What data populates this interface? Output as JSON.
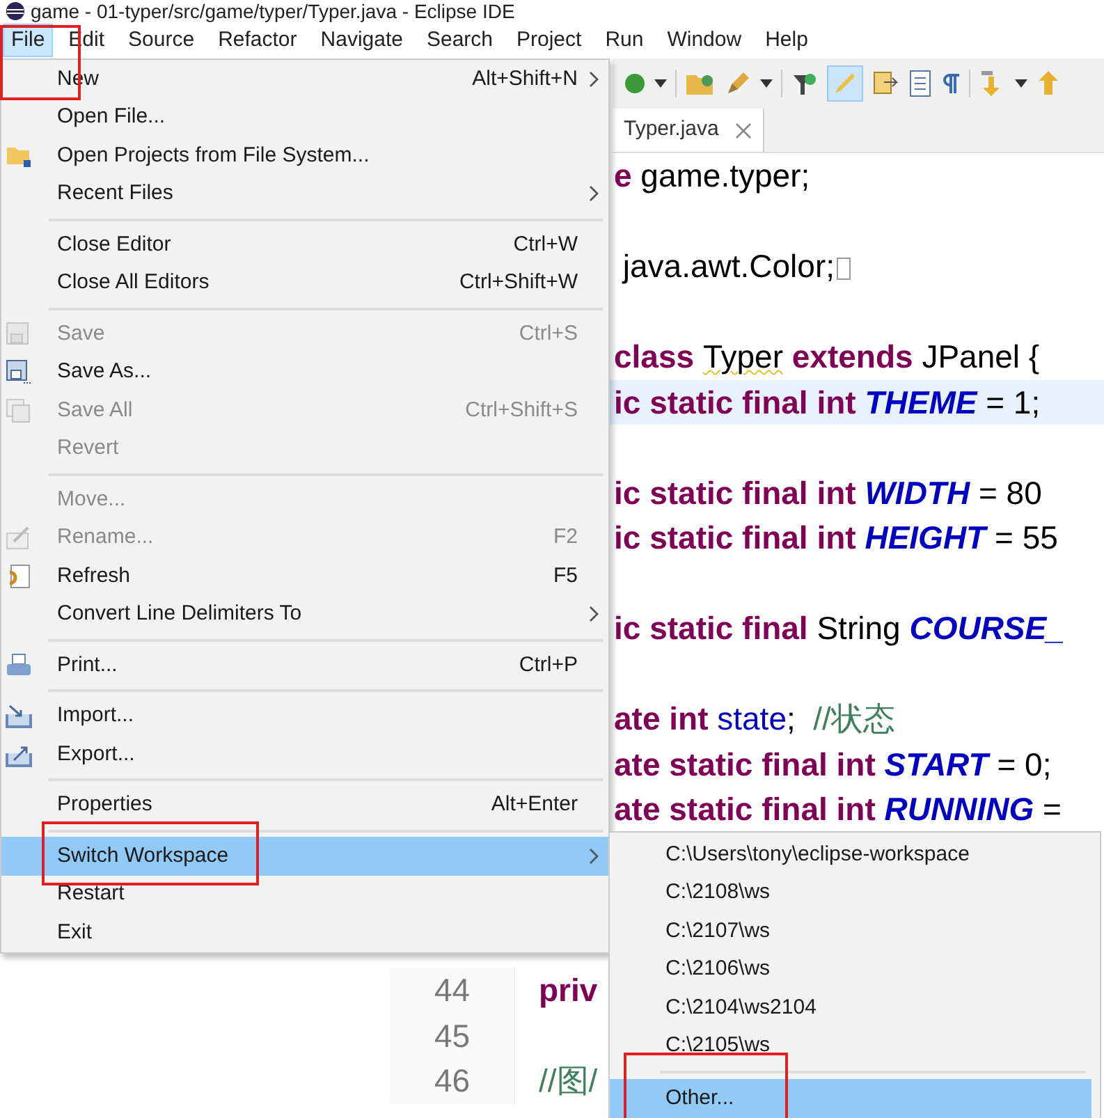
{
  "window": {
    "title": "game - 01-typer/src/game/typer/Typer.java - Eclipse IDE"
  },
  "menu_bar": [
    {
      "label": "File",
      "selected": true
    },
    {
      "label": "Edit",
      "selected": false
    },
    {
      "label": "Source",
      "selected": false
    },
    {
      "label": "Refactor",
      "selected": false
    },
    {
      "label": "Navigate",
      "selected": false
    },
    {
      "label": "Search",
      "selected": false
    },
    {
      "label": "Project",
      "selected": false
    },
    {
      "label": "Run",
      "selected": false
    },
    {
      "label": "Window",
      "selected": false
    },
    {
      "label": "Help",
      "selected": false
    }
  ],
  "editor_tab": {
    "label": "Typer.java"
  },
  "file_menu": [
    [
      {
        "label": "New",
        "shortcut": "Alt+Shift+N",
        "submenu": true,
        "disabled": false,
        "selected": false
      },
      {
        "label": "Open File...",
        "submenu": false,
        "disabled": false,
        "selected": false
      },
      {
        "label": "Open Projects from File System...",
        "submenu": false,
        "disabled": false,
        "selected": false
      },
      {
        "label": "Recent Files",
        "submenu": true,
        "disabled": false,
        "selected": false
      }
    ],
    [
      {
        "label": "Close Editor",
        "shortcut": "Ctrl+W",
        "submenu": false,
        "disabled": false,
        "selected": false
      },
      {
        "label": "Close All Editors",
        "shortcut": "Ctrl+Shift+W",
        "submenu": false,
        "disabled": false,
        "selected": false
      }
    ],
    [
      {
        "label": "Save",
        "shortcut": "Ctrl+S",
        "submenu": false,
        "disabled": true,
        "selected": false
      },
      {
        "label": "Save As...",
        "submenu": false,
        "disabled": false,
        "selected": false
      },
      {
        "label": "Save All",
        "shortcut": "Ctrl+Shift+S",
        "submenu": false,
        "disabled": true,
        "selected": false
      },
      {
        "label": "Revert",
        "submenu": false,
        "disabled": true,
        "selected": false
      }
    ],
    [
      {
        "label": "Move...",
        "submenu": false,
        "disabled": true,
        "selected": false
      },
      {
        "label": "Rename...",
        "shortcut": "F2",
        "submenu": false,
        "disabled": true,
        "selected": false
      },
      {
        "label": "Refresh",
        "shortcut": "F5",
        "submenu": false,
        "disabled": false,
        "selected": false
      },
      {
        "label": "Convert Line Delimiters To",
        "submenu": true,
        "disabled": false,
        "selected": false
      }
    ],
    [
      {
        "label": "Print...",
        "shortcut": "Ctrl+P",
        "submenu": false,
        "disabled": false,
        "selected": false
      }
    ],
    [
      {
        "label": "Import...",
        "submenu": false,
        "disabled": false,
        "selected": false
      },
      {
        "label": "Export...",
        "submenu": false,
        "disabled": false,
        "selected": false
      }
    ],
    [
      {
        "label": "Properties",
        "shortcut": "Alt+Enter",
        "submenu": false,
        "disabled": false,
        "selected": false
      }
    ],
    [
      {
        "label": "Switch Workspace",
        "submenu": true,
        "disabled": false,
        "selected": true
      },
      {
        "label": "Restart",
        "submenu": false,
        "disabled": false,
        "selected": false
      },
      {
        "label": "Exit",
        "submenu": false,
        "disabled": false,
        "selected": false
      }
    ]
  ],
  "workspace_submenu": [
    [
      {
        "label": "C:\\Users\\tony\\eclipse-workspace",
        "selected": false
      },
      {
        "label": "C:\\2108\\ws",
        "selected": false
      },
      {
        "label": "C:\\2107\\ws",
        "selected": false
      },
      {
        "label": "C:\\2106\\ws",
        "selected": false
      },
      {
        "label": "C:\\2104\\ws2104",
        "selected": false
      },
      {
        "label": "C:\\2105\\ws",
        "selected": false
      }
    ],
    [
      {
        "label": "Other...",
        "selected": true
      }
    ]
  ],
  "code_lines": [
    {
      "kind": "code",
      "highlighted": false,
      "tokens": [
        {
          "text": "e",
          "kind": "keyword"
        },
        {
          "text": " game.typer;",
          "kind": "plain"
        }
      ]
    },
    {
      "kind": "blank"
    },
    {
      "kind": "code",
      "highlighted": false,
      "folded": true,
      "tokens": [
        {
          "text": " java.awt.Color;",
          "kind": "plain"
        }
      ]
    },
    {
      "kind": "blank"
    },
    {
      "kind": "code",
      "highlighted": false,
      "tokens": [
        {
          "text": "class ",
          "kind": "keyword"
        },
        {
          "text": "Typer",
          "kind": "plain",
          "warning": true
        },
        {
          "text": " extends ",
          "kind": "keyword"
        },
        {
          "text": "JPanel {",
          "kind": "plain"
        }
      ]
    },
    {
      "kind": "code",
      "highlighted": true,
      "tokens": [
        {
          "text": "ic static final int ",
          "kind": "keyword"
        },
        {
          "text": "THEME",
          "kind": "constant"
        },
        {
          "text": " = 1;",
          "kind": "plain"
        }
      ]
    },
    {
      "kind": "blank"
    },
    {
      "kind": "code",
      "highlighted": false,
      "tokens": [
        {
          "text": "ic static final int ",
          "kind": "keyword"
        },
        {
          "text": "WIDTH",
          "kind": "constant"
        },
        {
          "text": " = 80",
          "kind": "plain"
        }
      ]
    },
    {
      "kind": "code",
      "highlighted": false,
      "tokens": [
        {
          "text": "ic static final int ",
          "kind": "keyword"
        },
        {
          "text": "HEIGHT",
          "kind": "constant"
        },
        {
          "text": " = 55",
          "kind": "plain"
        }
      ]
    },
    {
      "kind": "blank"
    },
    {
      "kind": "code",
      "highlighted": false,
      "tokens": [
        {
          "text": "ic static final ",
          "kind": "keyword"
        },
        {
          "text": "String ",
          "kind": "plain"
        },
        {
          "text": "COURSE_",
          "kind": "constant"
        }
      ]
    },
    {
      "kind": "blank"
    },
    {
      "kind": "code",
      "highlighted": false,
      "tokens": [
        {
          "text": "ate int ",
          "kind": "keyword"
        },
        {
          "text": "state",
          "kind": "field"
        },
        {
          "text": ";  ",
          "kind": "plain"
        },
        {
          "text": "//状态",
          "kind": "comment"
        }
      ]
    },
    {
      "kind": "code",
      "highlighted": false,
      "tokens": [
        {
          "text": "ate static final int ",
          "kind": "keyword"
        },
        {
          "text": "START",
          "kind": "constant"
        },
        {
          "text": " = 0;",
          "kind": "plain"
        }
      ]
    },
    {
      "kind": "code",
      "highlighted": false,
      "tokens": [
        {
          "text": "ate static final int ",
          "kind": "keyword"
        },
        {
          "text": "RUNNING",
          "kind": "constant"
        },
        {
          "text": " =",
          "kind": "plain"
        }
      ]
    }
  ],
  "numbered_lines": [
    {
      "number": "44",
      "tokens": [
        {
          "text": "priv",
          "kind": "keyword"
        }
      ]
    },
    {
      "number": "45"
    },
    {
      "number": "46",
      "tokens": [
        {
          "text": "//图/",
          "kind": "comment"
        }
      ]
    }
  ]
}
